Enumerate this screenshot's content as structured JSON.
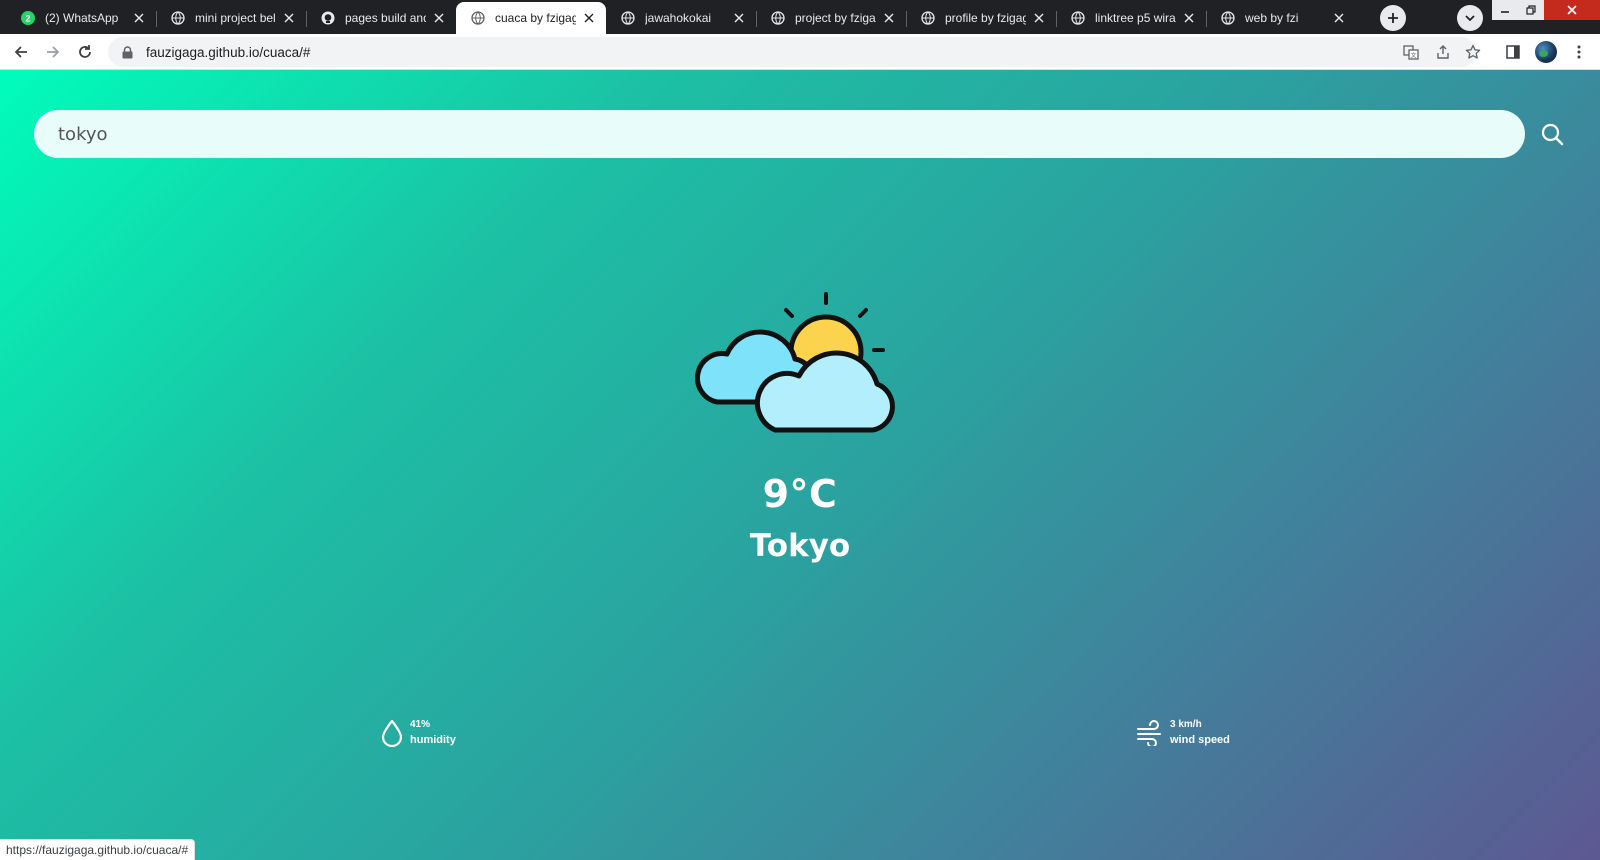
{
  "browser": {
    "tabs": [
      {
        "label": "(2) WhatsApp",
        "icon": "whatsapp-icon",
        "badge": "2",
        "active": false
      },
      {
        "label": "mini project bela",
        "icon": "globe-icon",
        "active": false
      },
      {
        "label": "pages build and",
        "icon": "github-icon",
        "active": false
      },
      {
        "label": "cuaca by fzigaga",
        "icon": "globe-icon",
        "active": true
      },
      {
        "label": "jawahokokai",
        "icon": "globe-icon",
        "active": false
      },
      {
        "label": "project by fziga",
        "icon": "globe-icon",
        "active": false
      },
      {
        "label": "profile by fzigag",
        "icon": "globe-icon",
        "active": false
      },
      {
        "label": "linktree p5 wira",
        "icon": "globe-icon",
        "active": false
      },
      {
        "label": "web by fzi",
        "icon": "globe-icon",
        "active": false
      }
    ],
    "url": "fauzigaga.github.io/cuaca/#",
    "status_url": "https://fauzigaga.github.io/cuaca/#"
  },
  "search": {
    "value": "tokyo",
    "placeholder": "",
    "icon": "search-icon"
  },
  "weather": {
    "icon": "partly-cloudy-icon",
    "temperature": "9°C",
    "city": "Tokyo",
    "humidity_value": "41%",
    "humidity_label": "humidity",
    "wind_value": "3 km/h",
    "wind_label": "wind speed"
  },
  "colors": {
    "gradient_start": "#00fdbb",
    "gradient_end": "#5d5892",
    "search_bg": "#e8fdfa",
    "sun": "#fcd34d",
    "cloud_back": "#7ee2fb",
    "cloud_front": "#b3eefc"
  }
}
